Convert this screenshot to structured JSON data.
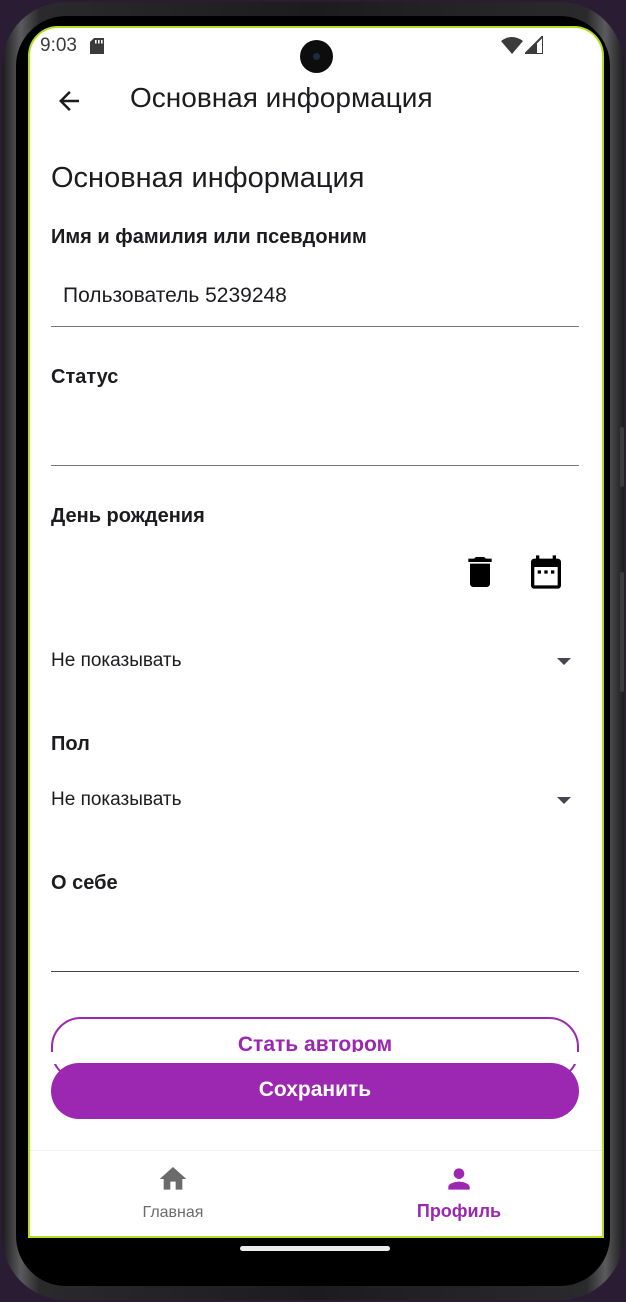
{
  "status_bar": {
    "time": "9:03"
  },
  "app_bar": {
    "title": "Основная информация"
  },
  "form": {
    "section_title": "Основная информация",
    "name": {
      "label": "Имя и фамилия или псевдоним",
      "value": "Пользователь 5239248"
    },
    "status": {
      "label": "Статус",
      "value": ""
    },
    "birthday": {
      "label": "День рождения",
      "visibility": "Не показывать"
    },
    "gender": {
      "label": "Пол",
      "value": "Не показывать"
    },
    "about": {
      "label": "О себе",
      "value": ""
    }
  },
  "buttons": {
    "become_author": "Стать автором",
    "save": "Сохранить"
  },
  "bottom_nav": {
    "items": [
      {
        "label": "Главная",
        "icon": "home-icon",
        "active": false
      },
      {
        "label": "Профиль",
        "icon": "person-icon",
        "active": true
      }
    ]
  },
  "colors": {
    "accent": "#9c27b0",
    "nav_inactive": "#6b6b6b",
    "text": "#1c1b1f",
    "underline": "#79747e"
  }
}
